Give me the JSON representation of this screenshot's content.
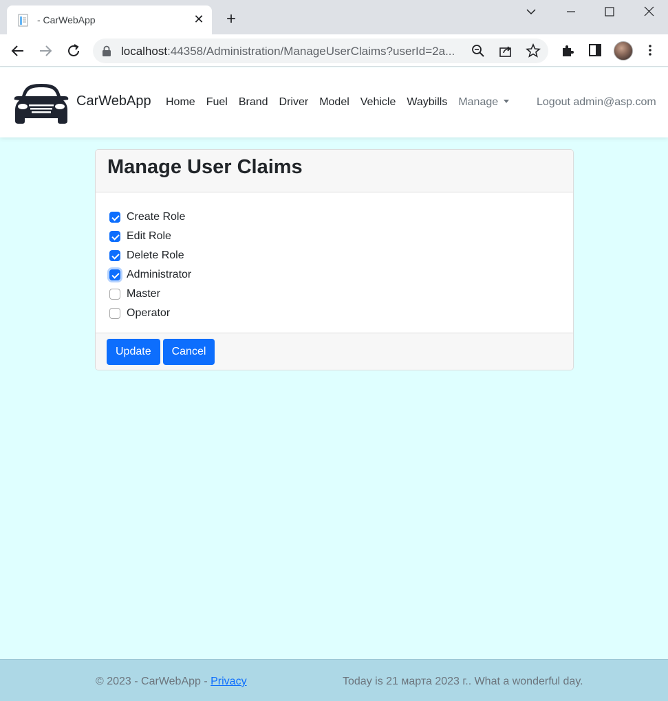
{
  "browser": {
    "tab_title": "- CarWebApp",
    "url_host": "localhost",
    "url_rest": ":44358/Administration/ManageUserClaims?userId=2a..."
  },
  "navbar": {
    "brand": "CarWebApp",
    "links": [
      "Home",
      "Fuel",
      "Brand",
      "Driver",
      "Model",
      "Vehicle",
      "Waybills"
    ],
    "manage_label": "Manage",
    "logout_label": "Logout admin@asp.com"
  },
  "card": {
    "title": "Manage User Claims",
    "claims": [
      {
        "label": "Create Role",
        "checked": true
      },
      {
        "label": "Edit Role",
        "checked": true
      },
      {
        "label": "Delete Role",
        "checked": true
      },
      {
        "label": "Administrator",
        "checked": true
      },
      {
        "label": "Master",
        "checked": false
      },
      {
        "label": "Operator",
        "checked": false
      }
    ],
    "update_label": "Update",
    "cancel_label": "Cancel"
  },
  "footer": {
    "copyright": "© 2023 - CarWebApp - ",
    "privacy_label": "Privacy",
    "date_text": "Today is 21 марта 2023 г.. What a wonderful day."
  },
  "colors": {
    "page_bg": "#dfffff",
    "footer_bg": "#add8e6",
    "primary": "#0d6efd"
  }
}
